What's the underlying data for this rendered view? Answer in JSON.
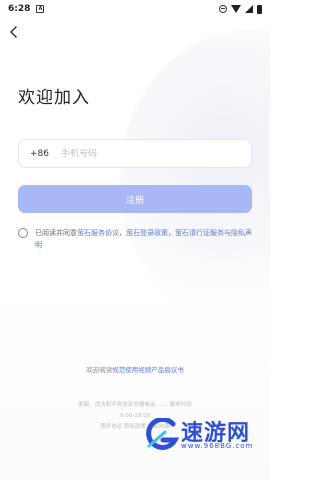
{
  "status_bar": {
    "time": "6:28",
    "notification_glyph": "A"
  },
  "page": {
    "title": "欢迎加入"
  },
  "phone": {
    "country_code": "+86",
    "placeholder": "手机号码",
    "value": ""
  },
  "register": {
    "label": "注册"
  },
  "agreement": {
    "prefix": "已阅读并同意",
    "link1": "萤石服务协议",
    "sep1": "，",
    "link2": "萤石登录政策",
    "sep2": "，",
    "link3": "萤石请行证服务与隐私声明"
  },
  "bottom": {
    "prefix": "欢迎阅读",
    "link": "规范使用视频产品倡议书"
  },
  "footer_faded": {
    "line1": "客服、违法和不良信息举报电话 …… 服务时间",
    "line2": "9:00-18:00",
    "line3": "服务协议 隐私政策 营业执照"
  },
  "watermark": {
    "brand": "速游网",
    "url": "www.968BG.com",
    "color": "#2f4fd6"
  },
  "colors": {
    "accent": "#5b7be0",
    "register_button": "#a8b7f5"
  }
}
